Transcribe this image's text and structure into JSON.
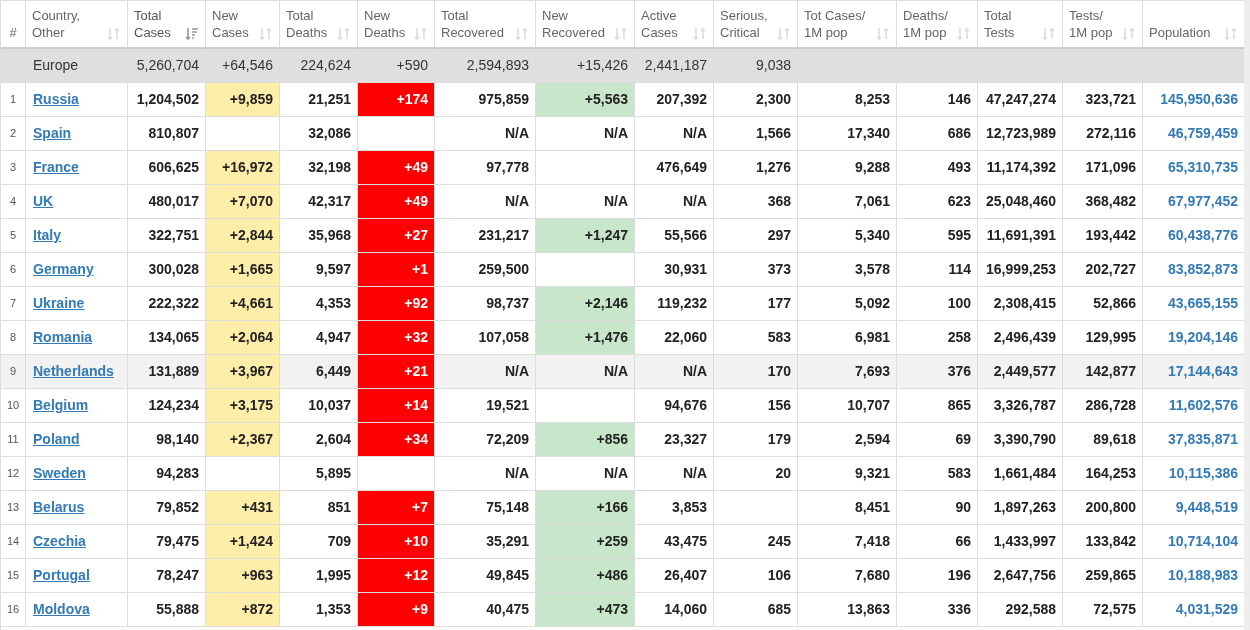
{
  "columns": [
    {
      "label": "#",
      "sortable": false,
      "sorted": false
    },
    {
      "label": "Country, Other",
      "sortable": true,
      "sorted": false
    },
    {
      "label": "Total Cases",
      "sortable": true,
      "sorted": true
    },
    {
      "label": "New Cases",
      "sortable": true,
      "sorted": false,
      "color": "#ffeeaa"
    },
    {
      "label": "Total Deaths",
      "sortable": true,
      "sorted": false
    },
    {
      "label": "New Deaths",
      "sortable": true,
      "sorted": false,
      "color": "#ff0000"
    },
    {
      "label": "Total Recovered",
      "sortable": true,
      "sorted": false
    },
    {
      "label": "New Recovered",
      "sortable": true,
      "sorted": false,
      "color": "#c8e6c9"
    },
    {
      "label": "Active Cases",
      "sortable": true,
      "sorted": false
    },
    {
      "label": "Serious, Critical",
      "sortable": true,
      "sorted": false
    },
    {
      "label": "Tot Cases/ 1M pop",
      "sortable": true,
      "sorted": false
    },
    {
      "label": "Deaths/ 1M pop",
      "sortable": true,
      "sorted": false
    },
    {
      "label": "Total Tests",
      "sortable": true,
      "sorted": false
    },
    {
      "label": "Tests/ 1M pop",
      "sortable": true,
      "sorted": false
    },
    {
      "label": "Population",
      "sortable": true,
      "sorted": false
    }
  ],
  "total_row": {
    "region": "Europe",
    "cells": [
      "5,260,704",
      "+64,546",
      "224,624",
      "+590",
      "2,594,893",
      "+15,426",
      "2,441,187",
      "9,038",
      "",
      "",
      "",
      "",
      ""
    ]
  },
  "rows": [
    {
      "rank": "1",
      "country": "Russia",
      "highlighted": false,
      "recovered_reported": true,
      "cells": [
        "1,204,502",
        "+9,859",
        "21,251",
        "+174",
        "975,859",
        "+5,563",
        "207,392",
        "2,300",
        "8,253",
        "146",
        "47,247,274",
        "323,721",
        "145,950,636"
      ]
    },
    {
      "rank": "2",
      "country": "Spain",
      "highlighted": false,
      "recovered_reported": false,
      "cells": [
        "810,807",
        "",
        "32,086",
        "",
        "N/A",
        "N/A",
        "N/A",
        "1,566",
        "17,340",
        "686",
        "12,723,989",
        "272,116",
        "46,759,459"
      ]
    },
    {
      "rank": "3",
      "country": "France",
      "highlighted": false,
      "recovered_reported": false,
      "cells": [
        "606,625",
        "+16,972",
        "32,198",
        "+49",
        "97,778",
        "",
        "476,649",
        "1,276",
        "9,288",
        "493",
        "11,174,392",
        "171,096",
        "65,310,735"
      ]
    },
    {
      "rank": "4",
      "country": "UK",
      "highlighted": false,
      "recovered_reported": false,
      "cells": [
        "480,017",
        "+7,070",
        "42,317",
        "+49",
        "N/A",
        "N/A",
        "N/A",
        "368",
        "7,061",
        "623",
        "25,048,460",
        "368,482",
        "67,977,452"
      ]
    },
    {
      "rank": "5",
      "country": "Italy",
      "highlighted": false,
      "recovered_reported": true,
      "cells": [
        "322,751",
        "+2,844",
        "35,968",
        "+27",
        "231,217",
        "+1,247",
        "55,566",
        "297",
        "5,340",
        "595",
        "11,691,391",
        "193,442",
        "60,438,776"
      ]
    },
    {
      "rank": "6",
      "country": "Germany",
      "highlighted": false,
      "recovered_reported": false,
      "cells": [
        "300,028",
        "+1,665",
        "9,597",
        "+1",
        "259,500",
        "",
        "30,931",
        "373",
        "3,578",
        "114",
        "16,999,253",
        "202,727",
        "83,852,873"
      ]
    },
    {
      "rank": "7",
      "country": "Ukraine",
      "highlighted": false,
      "recovered_reported": true,
      "cells": [
        "222,322",
        "+4,661",
        "4,353",
        "+92",
        "98,737",
        "+2,146",
        "119,232",
        "177",
        "5,092",
        "100",
        "2,308,415",
        "52,866",
        "43,665,155"
      ]
    },
    {
      "rank": "8",
      "country": "Romania",
      "highlighted": false,
      "recovered_reported": true,
      "cells": [
        "134,065",
        "+2,064",
        "4,947",
        "+32",
        "107,058",
        "+1,476",
        "22,060",
        "583",
        "6,981",
        "258",
        "2,496,439",
        "129,995",
        "19,204,146"
      ]
    },
    {
      "rank": "9",
      "country": "Netherlands",
      "highlighted": true,
      "recovered_reported": false,
      "cells": [
        "131,889",
        "+3,967",
        "6,449",
        "+21",
        "N/A",
        "N/A",
        "N/A",
        "170",
        "7,693",
        "376",
        "2,449,577",
        "142,877",
        "17,144,643"
      ]
    },
    {
      "rank": "10",
      "country": "Belgium",
      "highlighted": false,
      "recovered_reported": false,
      "cells": [
        "124,234",
        "+3,175",
        "10,037",
        "+14",
        "19,521",
        "",
        "94,676",
        "156",
        "10,707",
        "865",
        "3,326,787",
        "286,728",
        "11,602,576"
      ]
    },
    {
      "rank": "11",
      "country": "Poland",
      "highlighted": false,
      "recovered_reported": true,
      "cells": [
        "98,140",
        "+2,367",
        "2,604",
        "+34",
        "72,209",
        "+856",
        "23,327",
        "179",
        "2,594",
        "69",
        "3,390,790",
        "89,618",
        "37,835,871"
      ]
    },
    {
      "rank": "12",
      "country": "Sweden",
      "highlighted": false,
      "recovered_reported": false,
      "cells": [
        "94,283",
        "",
        "5,895",
        "",
        "N/A",
        "N/A",
        "N/A",
        "20",
        "9,321",
        "583",
        "1,661,484",
        "164,253",
        "10,115,386"
      ]
    },
    {
      "rank": "13",
      "country": "Belarus",
      "highlighted": false,
      "recovered_reported": true,
      "cells": [
        "79,852",
        "+431",
        "851",
        "+7",
        "75,148",
        "+166",
        "3,853",
        "",
        "8,451",
        "90",
        "1,897,263",
        "200,800",
        "9,448,519"
      ]
    },
    {
      "rank": "14",
      "country": "Czechia",
      "highlighted": false,
      "recovered_reported": true,
      "cells": [
        "79,475",
        "+1,424",
        "709",
        "+10",
        "35,291",
        "+259",
        "43,475",
        "245",
        "7,418",
        "66",
        "1,433,997",
        "133,842",
        "10,714,104"
      ]
    },
    {
      "rank": "15",
      "country": "Portugal",
      "highlighted": false,
      "recovered_reported": true,
      "cells": [
        "78,247",
        "+963",
        "1,995",
        "+12",
        "49,845",
        "+486",
        "26,407",
        "106",
        "7,680",
        "196",
        "2,647,756",
        "259,865",
        "10,188,983"
      ]
    },
    {
      "rank": "16",
      "country": "Moldova",
      "highlighted": false,
      "recovered_reported": true,
      "cells": [
        "55,888",
        "+872",
        "1,353",
        "+9",
        "40,475",
        "+473",
        "14,060",
        "685",
        "13,863",
        "336",
        "292,588",
        "72,575",
        "4,031,529"
      ]
    }
  ]
}
